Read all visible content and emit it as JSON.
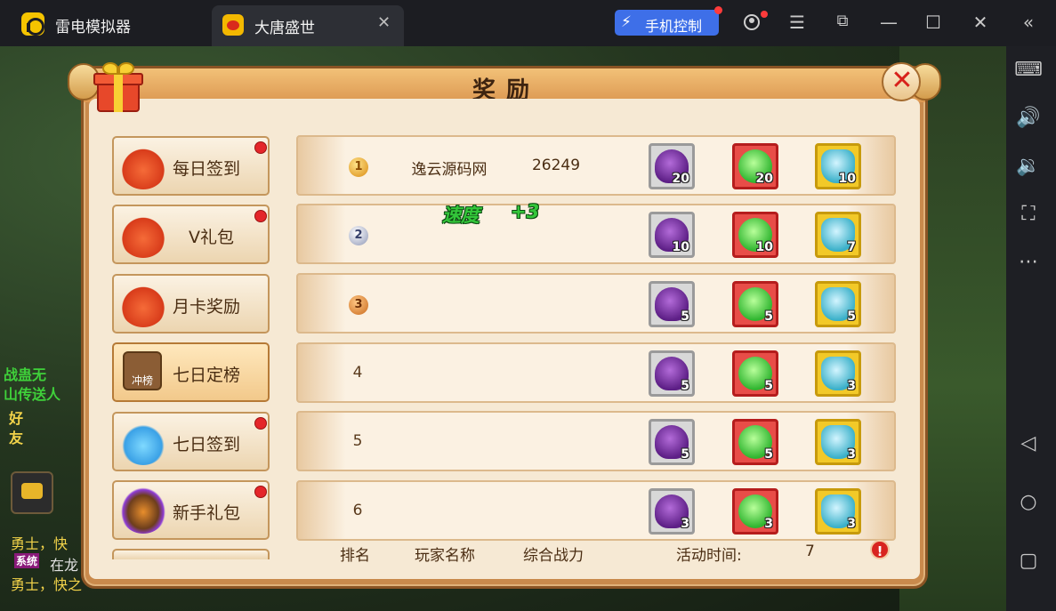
{
  "titlebar": {
    "app_title": "雷电模拟器",
    "tab_label": "大唐盛世",
    "phone_control": "手机控制"
  },
  "panel": {
    "title": "奖励"
  },
  "nav": [
    {
      "label": "每日签到",
      "icon": "red-bag-icon",
      "badge": true,
      "active": false
    },
    {
      "label": "V礼包",
      "icon": "red-bag-icon",
      "badge": true,
      "active": false
    },
    {
      "label": "月卡奖励",
      "icon": "red-bag-icon",
      "badge": false,
      "active": false
    },
    {
      "label": "七日定榜",
      "icon": "rank-chest-icon",
      "icon_text": "冲榜",
      "badge": false,
      "active": true
    },
    {
      "label": "七日签到",
      "icon": "blue-bag-icon",
      "badge": true,
      "active": false
    },
    {
      "label": "新手礼包",
      "icon": "egg-icon",
      "badge": true,
      "active": false
    }
  ],
  "rows": [
    {
      "rank": "1",
      "player": "逸云源码网",
      "power": "26249",
      "rewards": [
        "20",
        "20",
        "10"
      ]
    },
    {
      "rank": "2",
      "player": "",
      "power": "",
      "rewards": [
        "10",
        "10",
        "7"
      ]
    },
    {
      "rank": "3",
      "player": "",
      "power": "",
      "rewards": [
        "5",
        "5",
        "5"
      ]
    },
    {
      "rank": "4",
      "player": "",
      "power": "",
      "rewards": [
        "5",
        "5",
        "3"
      ]
    },
    {
      "rank": "5",
      "player": "",
      "power": "",
      "rewards": [
        "5",
        "5",
        "3"
      ]
    },
    {
      "rank": "6",
      "player": "",
      "power": "",
      "rewards": [
        "3",
        "3",
        "3"
      ]
    }
  ],
  "floating": {
    "speed_label": "速度",
    "speed_value": "+3"
  },
  "footer": {
    "rank_header": "排名",
    "player_header": "玩家名称",
    "power_header": "综合战力",
    "activity_time_label": "活动时间:",
    "activity_time_value": "7"
  },
  "game_text": {
    "left_1": "战蛊无",
    "left_2": "山传送人",
    "left_3": "好",
    "left_4": "友",
    "chat_1": "勇士，快",
    "chat_2": "在龙",
    "chat_3": "勇士，快之",
    "chat_tag": "系统"
  },
  "colors": {
    "accent_blue": "#3e6fe8",
    "badge_red": "#e4262a",
    "panel_bg": "#f6e9d4",
    "frame": "#c98a4c"
  }
}
